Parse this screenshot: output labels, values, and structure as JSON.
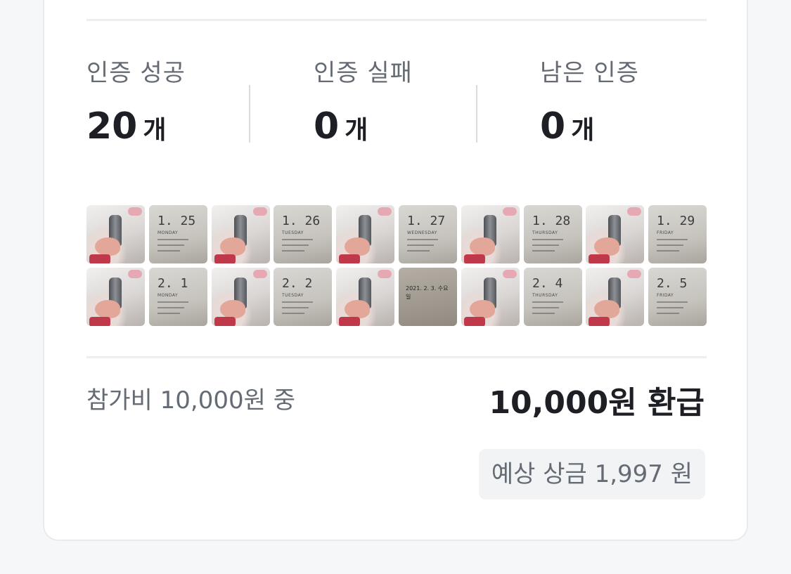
{
  "stats": {
    "success": {
      "label": "인증 성공",
      "value": "20",
      "unit": "개"
    },
    "fail": {
      "label": "인증 실패",
      "value": "0",
      "unit": "개"
    },
    "remaining": {
      "label": "남은 인증",
      "value": "0",
      "unit": "개"
    }
  },
  "photos": {
    "row1": [
      {
        "kind": "sink"
      },
      {
        "kind": "note",
        "date": "1. 25",
        "day": "MONDAY"
      },
      {
        "kind": "sink"
      },
      {
        "kind": "note",
        "date": "1. 26",
        "day": "TUESDAY"
      },
      {
        "kind": "sink"
      },
      {
        "kind": "note",
        "date": "1. 27",
        "day": "WEDNESDAY"
      },
      {
        "kind": "sink"
      },
      {
        "kind": "note",
        "date": "1. 28",
        "day": "THURSDAY"
      },
      {
        "kind": "sink"
      },
      {
        "kind": "note",
        "date": "1. 29",
        "day": "FRIDAY"
      }
    ],
    "row2": [
      {
        "kind": "sink"
      },
      {
        "kind": "note",
        "date": "2. 1",
        "day": "MONDAY"
      },
      {
        "kind": "sink"
      },
      {
        "kind": "note",
        "date": "2. 2",
        "day": "TUESDAY"
      },
      {
        "kind": "sink"
      },
      {
        "kind": "handwrite",
        "text": "2021. 2. 3. 수요일"
      },
      {
        "kind": "sink"
      },
      {
        "kind": "note",
        "date": "2. 4",
        "day": "THURSDAY"
      },
      {
        "kind": "sink"
      },
      {
        "kind": "note",
        "date": "2. 5",
        "day": "FRIDAY"
      }
    ]
  },
  "summary": {
    "fee_label": "참가비 10,000원 중",
    "refund_label": "10,000원 환급",
    "prize_label": "예상 상금 1,997 원"
  }
}
